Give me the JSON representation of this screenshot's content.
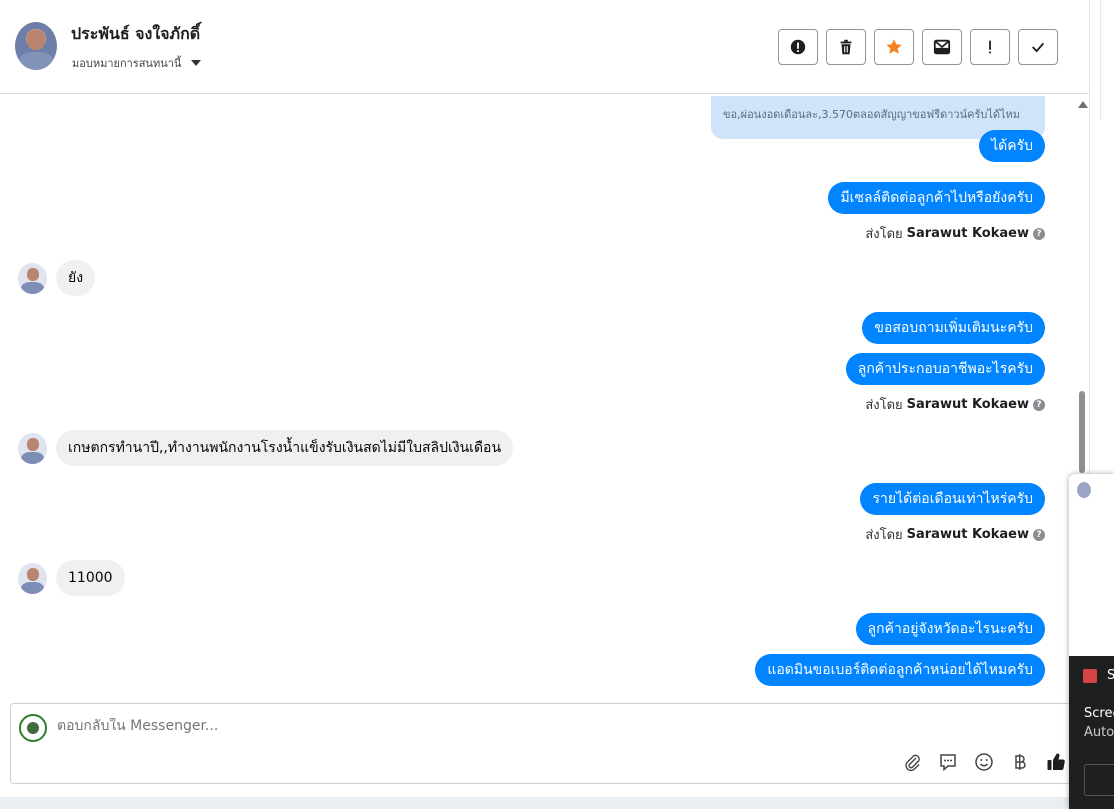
{
  "header": {
    "contact_name": "ประพันธ์ จงใจภักดิ์",
    "assign_label": "มอบหมายการสนทนานี้",
    "actions": [
      "mark-spam",
      "delete",
      "star",
      "move-to-inbox",
      "follow-up",
      "done"
    ]
  },
  "messages": {
    "faded_outgoing": "ขอ,ผ่อนงอดเดือนละ,3.570ตลอดสัญญาขอฟรีดาวน์ครับได้ไหม",
    "out1": "ได้ครับ",
    "out2": "มีเซลล์ติดต่อลูกค้าไปหรือยังครับ",
    "sent_by_prefix": "ส่งโดย",
    "sent_by_name": "Sarawut Kokaew",
    "in1": "ยัง",
    "out3": "ขอสอบถามเพิ่มเติมนะครับ",
    "out4": "ลูกค้าประกอบอาชีพอะไรครับ",
    "in2": "เกษตกรทำนาปี,,ทำงานพนักงานโรงน้ำแข็งรับเงินสดไม่มีใบสลิปเงินเดือน",
    "out5": "รายได้ต่อเดือนเท่าไหร่ครับ",
    "in3": "11000",
    "out6": "ลูกค้าอยู่จังหวัดอะไรนะครับ",
    "out7": "แอดมินขอเบอร์ติดต่อลูกค้าหน่อยได้ไหมครับ"
  },
  "composer": {
    "placeholder": "ตอบกลับใน Messenger..."
  },
  "popup": {
    "title_initial": "S",
    "line1": "Scree",
    "line2": "Auto"
  },
  "colors": {
    "outgoing_bubble": "#0084ff",
    "incoming_bubble": "#f0f0f0",
    "star": "#f5821f",
    "like": "#1c1e21"
  },
  "icons": {
    "attach": "paperclip-icon",
    "saved_replies": "chat-bubble-icon",
    "emoji": "smiley-icon",
    "currency": "baht-icon",
    "like": "thumbs-up-icon"
  }
}
